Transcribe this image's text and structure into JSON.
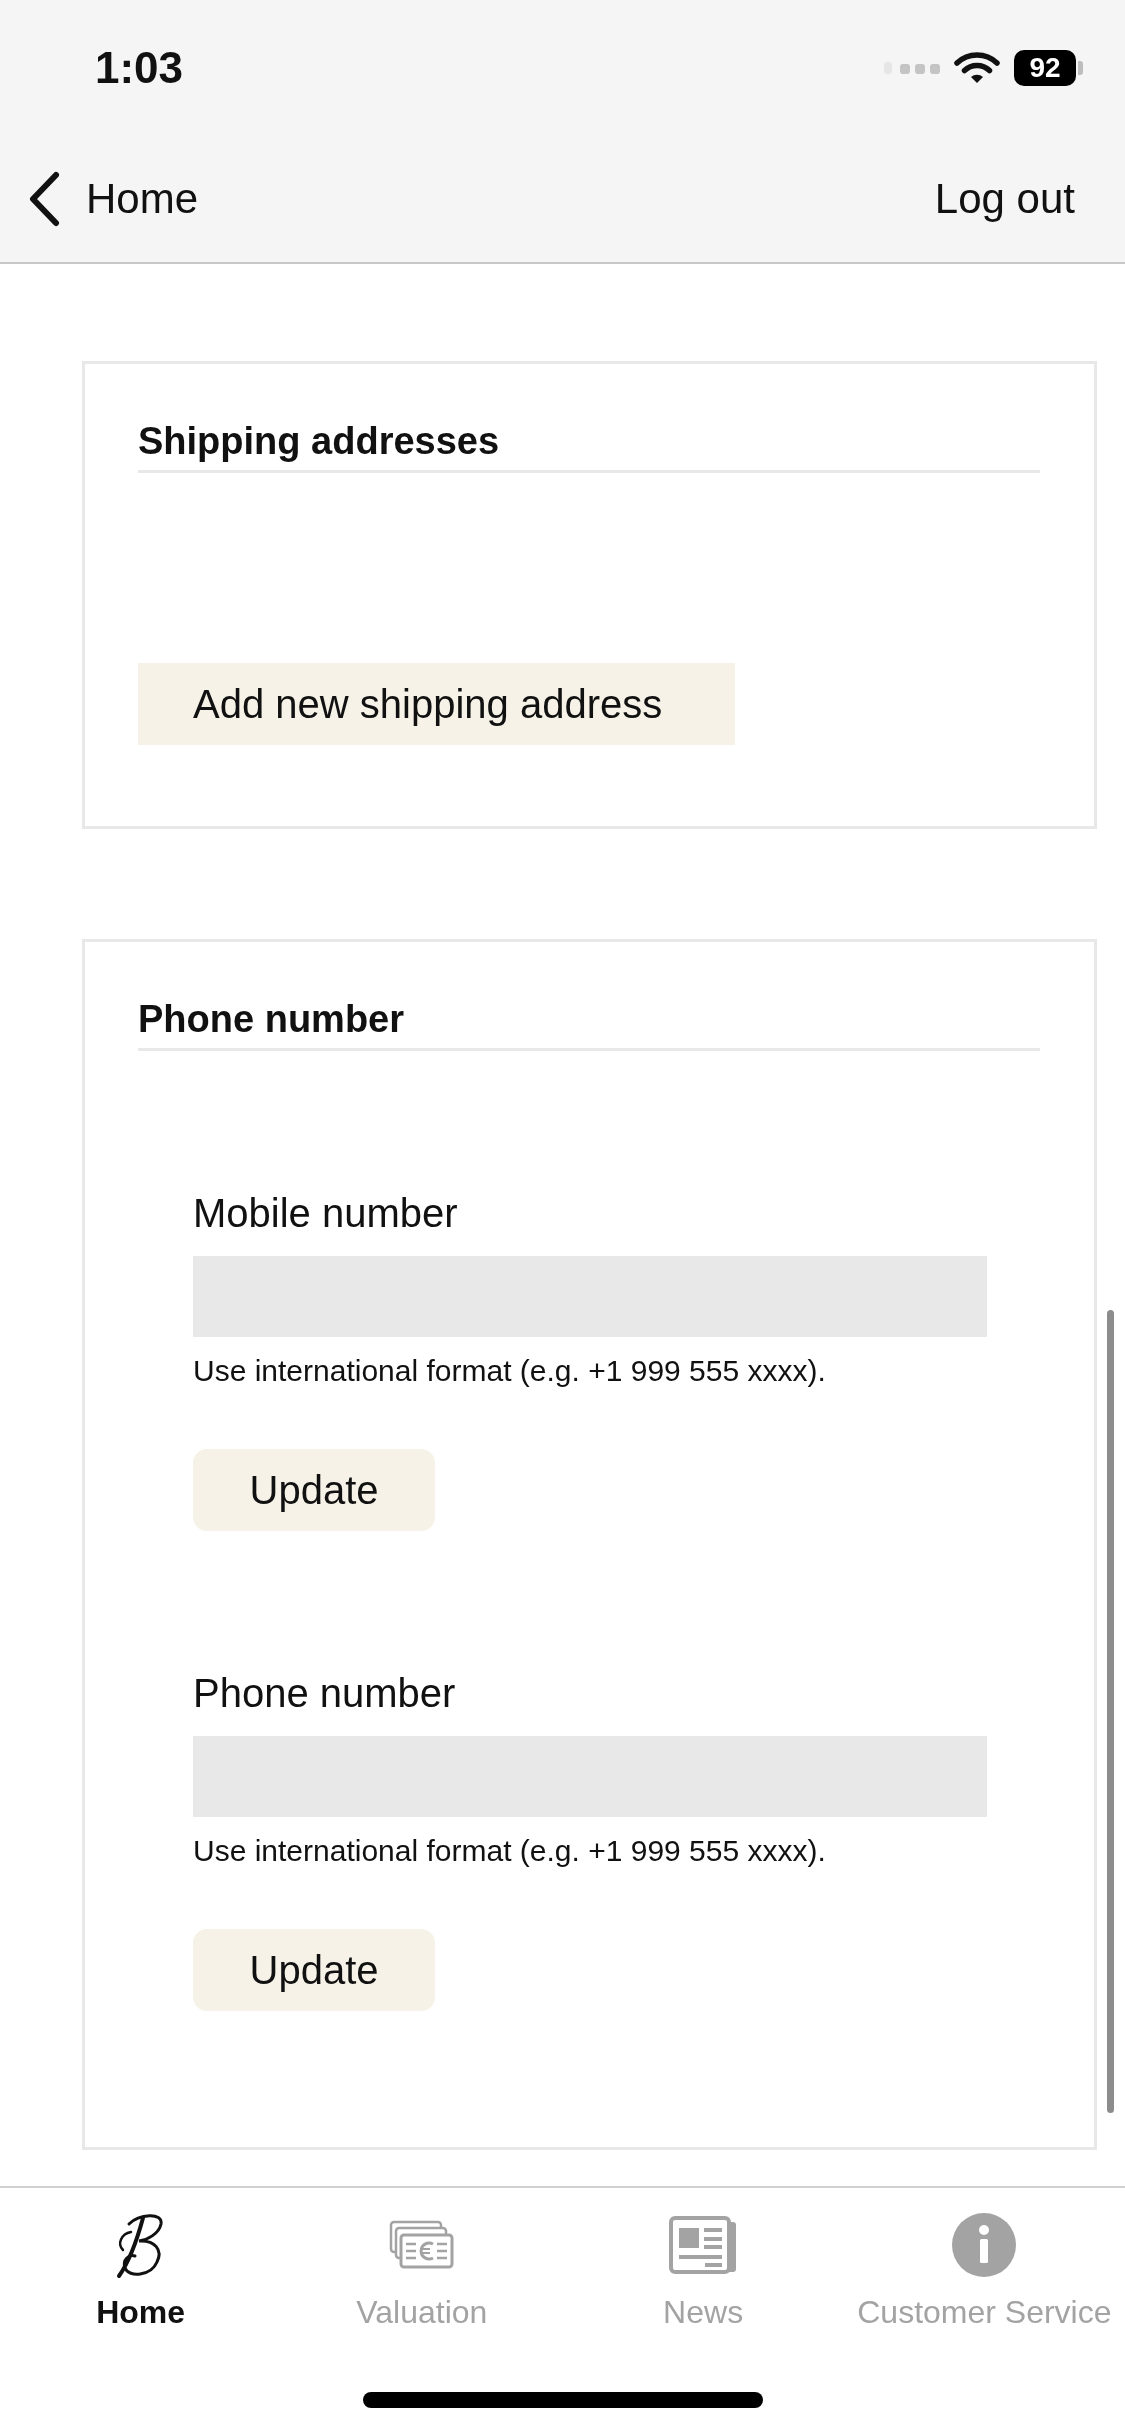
{
  "status_bar": {
    "time": "1:03",
    "battery": "92"
  },
  "nav_bar": {
    "back": "Home",
    "log_out": "Log out"
  },
  "shipping_addresses": {
    "title": "Shipping addresses",
    "add_button": "Add new shipping address"
  },
  "phone_number": {
    "title": "Phone number",
    "fields": [
      {
        "label": "Mobile number",
        "hint": "Use international format (e.g. +1 999 555 xxxx).",
        "button": "Update"
      },
      {
        "label": "Phone number",
        "hint": "Use international format (e.g. +1 999 555 xxxx).",
        "button": "Update"
      }
    ]
  },
  "tab_bar": [
    {
      "label": "Home",
      "selected": true
    },
    {
      "label": "Valuation",
      "selected": false
    },
    {
      "label": "News",
      "selected": false
    },
    {
      "label": "Customer Service",
      "selected": false
    }
  ]
}
